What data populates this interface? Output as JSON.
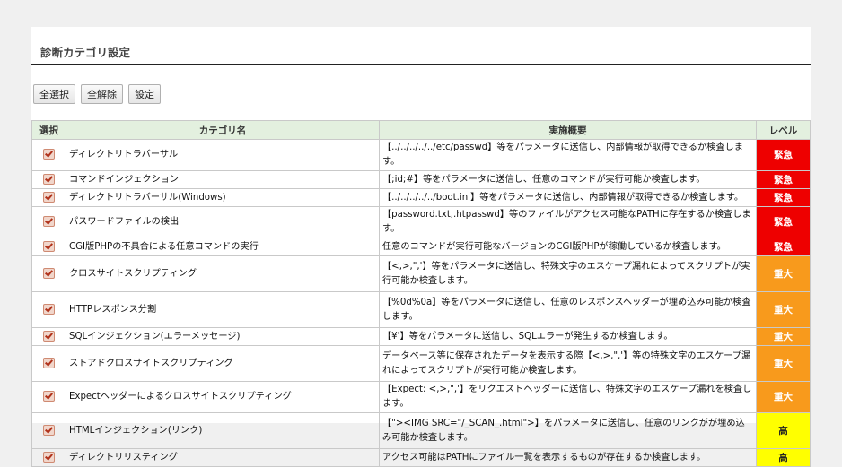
{
  "page": {
    "title": "診断カテゴリ設定"
  },
  "buttons": {
    "select_all": "全選択",
    "deselect_all": "全解除",
    "settings": "設定"
  },
  "table": {
    "headers": {
      "select": "選択",
      "category": "カテゴリ名",
      "summary": "実施概要",
      "level": "レベル"
    },
    "rows": [
      {
        "checked": true,
        "category": "ディレクトリトラバーサル",
        "summary": "【../../../../../etc/passwd】等をパラメータに送信し、内部情報が取得できるか検査します。",
        "level": "緊急",
        "level_type": "emerg"
      },
      {
        "checked": true,
        "category": "コマンドインジェクション",
        "summary": "【;id;#】等をパラメータに送信し、任意のコマンドが実行可能か検査します。",
        "level": "緊急",
        "level_type": "emerg"
      },
      {
        "checked": true,
        "category": "ディレクトリトラバーサル(Windows)",
        "summary": "【../../../../../boot.ini】等をパラメータに送信し、内部情報が取得できるか検査します。",
        "level": "緊急",
        "level_type": "emerg"
      },
      {
        "checked": true,
        "category": "パスワードファイルの検出",
        "summary": "【password.txt,.htpasswd】等のファイルがアクセス可能なPATHに存在するか検査します。",
        "level": "緊急",
        "level_type": "emerg"
      },
      {
        "checked": true,
        "category": "CGI版PHPの不具合による任意コマンドの実行",
        "summary": "任意のコマンドが実行可能なバージョンのCGI版PHPが稼働しているか検査します。",
        "level": "緊急",
        "level_type": "emerg"
      },
      {
        "checked": true,
        "category": "クロスサイトスクリプティング",
        "summary": "【<,>,\",'】等をパラメータに送信し、特殊文字のエスケープ漏れによってスクリプトが実行可能か検査します。",
        "level": "重大",
        "level_type": "major"
      },
      {
        "checked": true,
        "category": "HTTPレスポンス分割",
        "summary": "【%0d%0a】等をパラメータに送信し、任意のレスポンスヘッダーが埋め込み可能か検査します。",
        "level": "重大",
        "level_type": "major"
      },
      {
        "checked": true,
        "category": "SQLインジェクション(エラーメッセージ)",
        "summary": "【¥'】等をパラメータに送信し、SQLエラーが発生するか検査します。",
        "level": "重大",
        "level_type": "major"
      },
      {
        "checked": true,
        "category": "ストアドクロスサイトスクリプティング",
        "summary": "データベース等に保存されたデータを表示する際【<,>,\",'】等の特殊文字のエスケープ漏れによってスクリプトが実行可能か検査します。",
        "level": "重大",
        "level_type": "major"
      },
      {
        "checked": true,
        "category": "Expectヘッダーによるクロスサイトスクリプティング",
        "summary": "【Expect: <,>,\",'】をリクエストヘッダーに送信し、特殊文字のエスケープ漏れを検査します。",
        "level": "重大",
        "level_type": "major"
      },
      {
        "checked": true,
        "category": "HTMLインジェクション(リンク)",
        "summary": "【\"><IMG SRC=\"/_SCAN_.html\">】をパラメータに送信し、任意のリンクがが埋め込み可能か検査します。",
        "level": "高",
        "level_type": "high"
      },
      {
        "checked": true,
        "category": "ディレクトリリスティング",
        "summary": "アクセス可能はPATHにファイル一覧を表示するものが存在するか検査します。",
        "level": "高",
        "level_type": "high"
      }
    ]
  },
  "colors": {
    "emerg": "#ee0000",
    "major": "#f89a1c",
    "high": "#ffff00",
    "header_bg": "#e3f0df"
  },
  "icons": {
    "checkbox": "checkbox-checked-icon"
  }
}
